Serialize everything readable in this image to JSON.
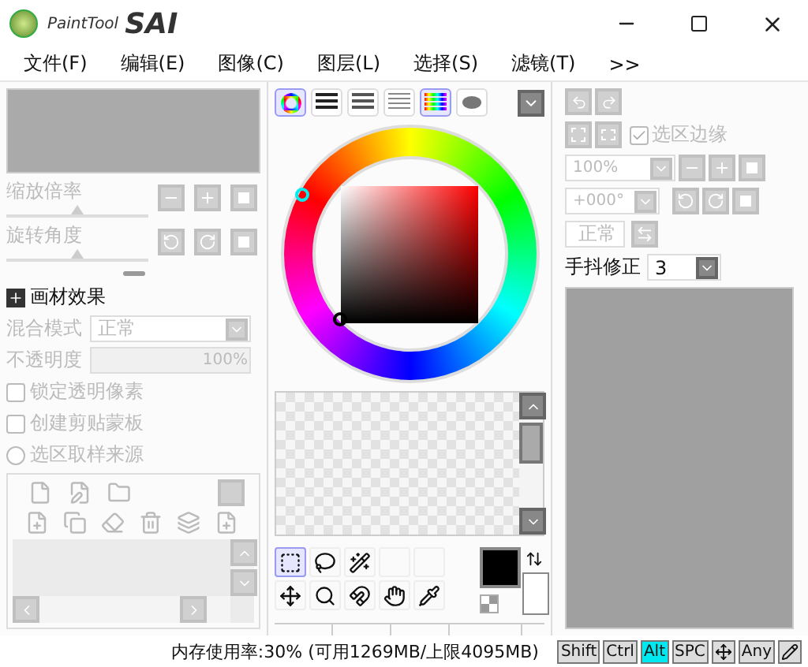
{
  "window": {
    "logo_text": "PaintTool",
    "logo_text_2": "SAI"
  },
  "menu": [
    "文件(F)",
    "编辑(E)",
    "图像(C)",
    "图层(L)",
    "选择(S)",
    "滤镜(T)",
    ">>"
  ],
  "navigator": {
    "sliders": [
      {
        "label": "缩放倍率",
        "level": 0.5
      },
      {
        "label": "旋转角度",
        "level": 0.5
      }
    ]
  },
  "layer_props": {
    "texture_label": "画材效果",
    "blend_label": "混合模式",
    "blend_value": "正常",
    "opacity_label": "不透明度",
    "opacity_value": "100%",
    "options": [
      {
        "kind": "checkbox",
        "label": "锁定透明像素",
        "checked": false
      },
      {
        "kind": "checkbox",
        "label": "创建剪贴蒙板",
        "checked": false
      },
      {
        "kind": "radio",
        "label": "选区取样来源",
        "checked": false
      }
    ]
  },
  "color_tabs": [
    {
      "selected": true
    },
    {
      "selected": false
    },
    {
      "selected": false
    },
    {
      "selected": false
    },
    {
      "selected": true
    },
    {
      "selected": false
    }
  ],
  "tools": [
    {
      "selected": true
    },
    {
      "selected": false
    },
    {
      "selected": false
    },
    {
      "selected": false
    },
    {
      "selected": false
    },
    {
      "selected": false
    },
    {
      "selected": false
    },
    {
      "selected": false
    }
  ],
  "view": {
    "selection_edge": {
      "label": "选区边缘",
      "checked": true
    },
    "zoom_value": "100%",
    "rotation_value": "+000°",
    "blend_button": "正常",
    "stabilizer": {
      "label": "手抖修正",
      "value": "3"
    }
  },
  "status_bar": {
    "memory": "内存使用率:30% (可用1269MB/上限4095MB)",
    "keys": [
      {
        "label": "Shift",
        "on": false
      },
      {
        "label": "Ctrl",
        "on": false
      },
      {
        "label": "Alt",
        "on": true
      },
      {
        "label": "SPC",
        "on": false
      }
    ],
    "key_any": "Any"
  }
}
